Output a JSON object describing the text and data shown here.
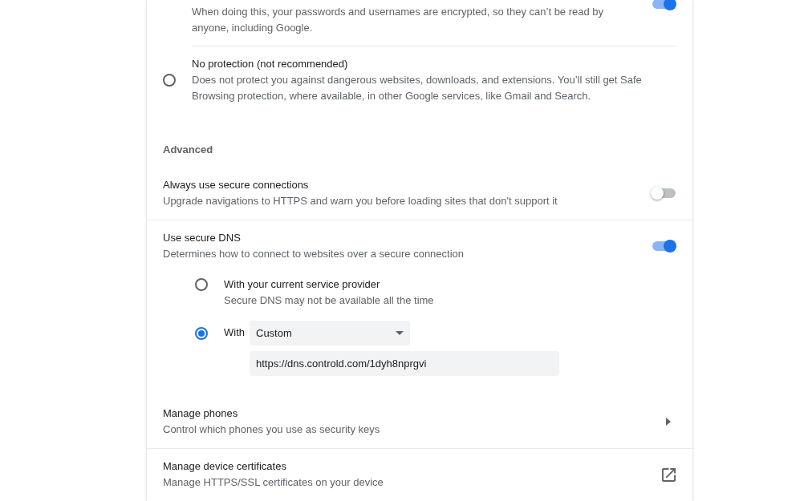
{
  "partial_setting": {
    "description": "When doing this, your passwords and usernames are encrypted, so they can’t be read by anyone, including Google.",
    "on": true
  },
  "protection_options": [
    {
      "title": "No protection (not recommended)",
      "description": "Does not protect you against dangerous websites, downloads, and extensions. You’ll still get Safe Browsing protection, where available, in other Google services, like Gmail and Search.",
      "selected": false
    }
  ],
  "advanced": {
    "heading": "Advanced",
    "settings": [
      {
        "kind": "toggle",
        "title": "Always use secure connections",
        "description": "Upgrade navigations to HTTPS and warn you before loading sites that don't support it",
        "on": false
      },
      {
        "kind": "toggle",
        "title": "Use secure DNS",
        "description": "Determines how to connect to websites over a secure connection",
        "on": true,
        "dns_options": [
          {
            "kind": "plain",
            "label": "With your current service provider",
            "description": "Secure DNS may not be available all the time",
            "selected": false
          },
          {
            "kind": "custom",
            "label": "With",
            "provider": "Custom",
            "url": "https://dns.controld.com/1dyh8nprgvi",
            "selected": true
          }
        ]
      },
      {
        "kind": "subpage",
        "title": "Manage phones",
        "description": "Control which phones you use as security keys"
      },
      {
        "kind": "external",
        "title": "Manage device certificates",
        "description": "Manage HTTPS/SSL certificates on your device"
      }
    ]
  }
}
